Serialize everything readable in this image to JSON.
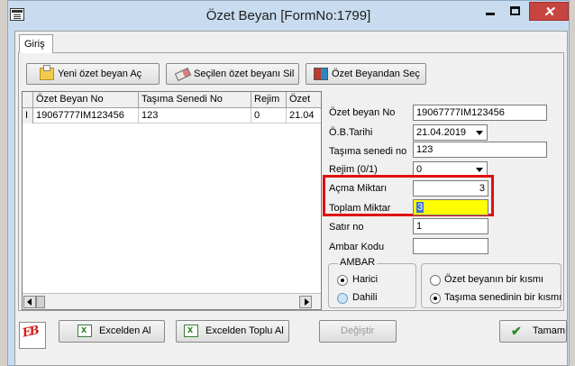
{
  "window": {
    "title": "Özet Beyan [FormNo:1799]",
    "controls": {
      "minimize": "min",
      "maximize": "max",
      "close": "✕"
    }
  },
  "tab": {
    "label": "Giriş"
  },
  "toolbar": {
    "open_label": "Yeni özet beyan Aç",
    "delete_label": "Seçilen özet beyanı Sil",
    "select_label": "Özet Beyandan Seç"
  },
  "grid": {
    "columns": [
      "Özet Beyan No",
      "Taşıma Senedi No",
      "Rejim",
      "Özet"
    ],
    "rows": [
      {
        "indicator": "I",
        "cells": [
          "19067777IM123456",
          "123",
          "0",
          "21.04"
        ]
      }
    ]
  },
  "form": {
    "ozet_beyan_no": {
      "label": "Özet beyan No",
      "value": "19067777IM123456"
    },
    "ob_tarihi": {
      "label": "Ö.B.Tarihi",
      "value": "21.04.2019"
    },
    "tasima_senedi_no": {
      "label": "Taşıma senedi no",
      "value": "123"
    },
    "rejim": {
      "label": "Rejim  (0/1)",
      "value": "0"
    },
    "acma_miktari": {
      "label": "Açma Miktarı",
      "value": "3"
    },
    "toplam_miktar": {
      "label": "Toplam Miktar",
      "value": "3"
    },
    "satir_no": {
      "label": "Satır no",
      "value": "1"
    },
    "ambar_kodu": {
      "label": "Ambar Kodu",
      "value": ""
    }
  },
  "ambar": {
    "title": "AMBAR",
    "options": [
      "Harici",
      "Dahili"
    ],
    "selected": "Harici"
  },
  "scope": {
    "options": [
      "Özet beyanın bir kısmı",
      "Taşıma senedinin bir kısmı"
    ],
    "selected": "Taşıma senedinin bir kısmı"
  },
  "footer": {
    "excel_label": "Excelden Al",
    "excel_bulk_label": "Excelden Toplu Al",
    "change_label": "Değiştir",
    "ok_label": "Tamam"
  },
  "colors": {
    "highlight_border": "#e01010",
    "toplam_field_bg": "#ffff00",
    "title_bar": "#c9dcef"
  }
}
